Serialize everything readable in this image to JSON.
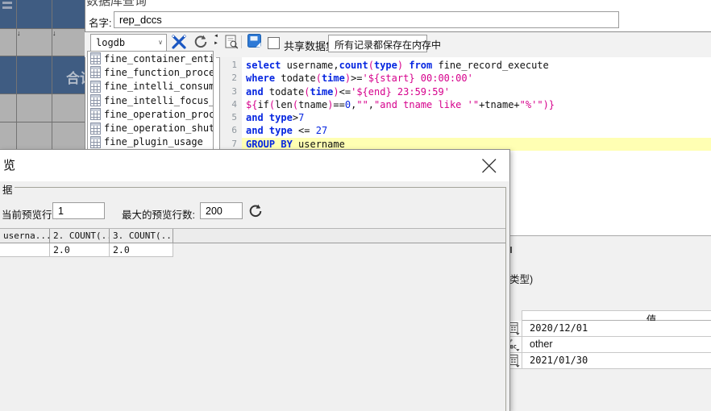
{
  "window": {
    "title": "数据库查询",
    "name_label": "名字:",
    "name_value": "rep_dccs"
  },
  "grid": {
    "total_label": "合计"
  },
  "left_pane": {
    "db_name": "logdb",
    "tables": [
      "fine_container_entity",
      "fine_function_process",
      "fine_intelli_consume_p",
      "fine_intelli_focus_po",
      "fine_operation_proces",
      "fine_operation_shutdo",
      "fine_plugin_usage"
    ]
  },
  "toolbar": {
    "share_dataset_label": "共享数据集",
    "storage_mode_value": "所有记录都保存在内存中"
  },
  "sql": {
    "lines": [
      [
        {
          "c": "k",
          "t": "select"
        },
        {
          "c": "d",
          "t": " username,"
        },
        {
          "c": "k",
          "t": "count"
        },
        {
          "c": "p",
          "t": "("
        },
        {
          "c": "k",
          "t": "type"
        },
        {
          "c": "p",
          "t": ")"
        },
        {
          "c": "d",
          "t": " "
        },
        {
          "c": "k",
          "t": "from"
        },
        {
          "c": "d",
          "t": " fine_record_execute"
        }
      ],
      [
        {
          "c": "k",
          "t": "where"
        },
        {
          "c": "d",
          "t": " todate"
        },
        {
          "c": "p",
          "t": "("
        },
        {
          "c": "k",
          "t": "time"
        },
        {
          "c": "p",
          "t": ")"
        },
        {
          "c": "d",
          "t": ">="
        },
        {
          "c": "p",
          "t": "'${start} 00:00:00'"
        }
      ],
      [
        {
          "c": "k",
          "t": "and"
        },
        {
          "c": "d",
          "t": " todate"
        },
        {
          "c": "p",
          "t": "("
        },
        {
          "c": "k",
          "t": "time"
        },
        {
          "c": "p",
          "t": ")"
        },
        {
          "c": "d",
          "t": "<="
        },
        {
          "c": "p",
          "t": "'${end} 23:59:59'"
        }
      ],
      [
        {
          "c": "p",
          "t": "${"
        },
        {
          "c": "d",
          "t": "if"
        },
        {
          "c": "p",
          "t": "("
        },
        {
          "c": "d",
          "t": "len"
        },
        {
          "c": "p",
          "t": "("
        },
        {
          "c": "d",
          "t": "tname"
        },
        {
          "c": "p",
          "t": ")"
        },
        {
          "c": "d",
          "t": "=="
        },
        {
          "c": "n",
          "t": "0"
        },
        {
          "c": "d",
          "t": ","
        },
        {
          "c": "p",
          "t": "\"\""
        },
        {
          "c": "d",
          "t": ","
        },
        {
          "c": "p",
          "t": "\"and tname like '\""
        },
        {
          "c": "d",
          "t": "+tname+"
        },
        {
          "c": "p",
          "t": "\"%'\""
        },
        {
          "c": "p",
          "t": ")}"
        }
      ],
      [
        {
          "c": "k",
          "t": "and"
        },
        {
          "c": "d",
          "t": " "
        },
        {
          "c": "k",
          "t": "type"
        },
        {
          "c": "d",
          "t": ">"
        },
        {
          "c": "n",
          "t": "7"
        }
      ],
      [
        {
          "c": "k",
          "t": "and"
        },
        {
          "c": "d",
          "t": " "
        },
        {
          "c": "k",
          "t": "type"
        },
        {
          "c": "d",
          "t": " <= "
        },
        {
          "c": "n",
          "t": "27"
        }
      ],
      [
        {
          "c": "k",
          "t": "GROUP BY"
        },
        {
          "c": "d",
          "t": " username"
        }
      ]
    ]
  },
  "preview": {
    "title_fragment": "览",
    "group_label_fragment": "据",
    "current_rows_label": "当前预览行数:",
    "current_rows_value": "1",
    "max_rows_label": "最大的预览行数:",
    "max_rows_value": "200",
    "table": {
      "headers": [
        "userna...",
        "2. COUNT(...",
        "3. COUNT(..."
      ],
      "rows": [
        [
          "",
          "2.0",
          "2.0"
        ]
      ]
    }
  },
  "params": {
    "hint_fragment": "类型)",
    "value_header": "值",
    "rows": [
      {
        "icon": "calendar-icon",
        "value": "2020/12/01",
        "mono": true
      },
      {
        "icon": "abc-icon",
        "value": "other",
        "mono": false
      },
      {
        "icon": "calendar-icon",
        "value": "2021/01/30",
        "mono": true
      }
    ]
  },
  "colors": {
    "keyword_blue": "#0626e0",
    "string_pink": "#d6008c",
    "active_line_yellow": "#ffffb3",
    "report_header_blue": "#3f5c82"
  }
}
